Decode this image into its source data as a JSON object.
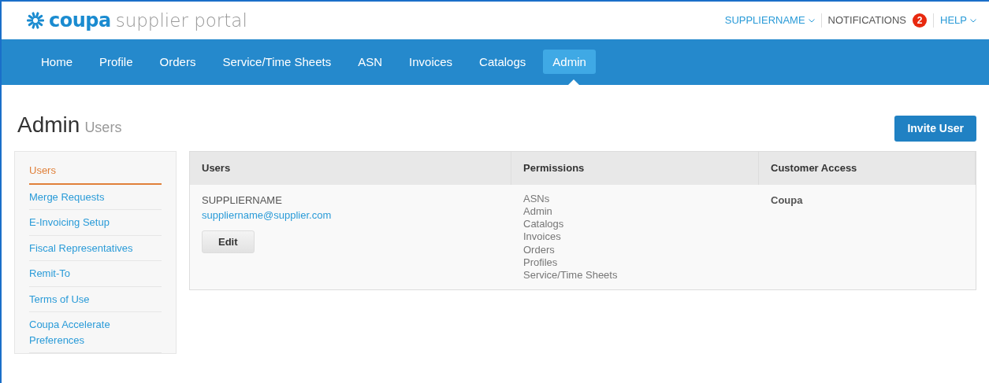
{
  "logo": {
    "brand": "coupa",
    "product": "supplier portal"
  },
  "top_links": [
    {
      "kind": "menu",
      "label": "SUPPLIERNAME"
    },
    {
      "kind": "badge",
      "label": "NOTIFICATIONS",
      "count": "2"
    },
    {
      "kind": "menu",
      "label": "HELP"
    }
  ],
  "tabs": [
    {
      "label": "Home",
      "selected": false
    },
    {
      "label": "Profile",
      "selected": false
    },
    {
      "label": "Orders",
      "selected": false
    },
    {
      "label": "Service/Time Sheets",
      "selected": false
    },
    {
      "label": "ASN",
      "selected": false
    },
    {
      "label": "Invoices",
      "selected": false
    },
    {
      "label": "Catalogs",
      "selected": false
    },
    {
      "label": "Admin",
      "selected": true
    }
  ],
  "page_title": {
    "main": "Admin",
    "sub": "Users"
  },
  "invite_button": "Invite User",
  "sidebar": {
    "items": [
      {
        "label": "Users",
        "selected": true
      },
      {
        "label": "Merge Requests",
        "selected": false
      },
      {
        "label": "E-Invoicing Setup",
        "selected": false
      },
      {
        "label": "Fiscal Representatives",
        "selected": false
      },
      {
        "label": "Remit-To",
        "selected": false
      },
      {
        "label": "Terms of Use",
        "selected": false
      },
      {
        "label": "Coupa Accelerate Preferences",
        "selected": false
      }
    ]
  },
  "table": {
    "columns": [
      "Users",
      "Permissions",
      "Customer Access"
    ],
    "rows": [
      {
        "name": "SUPPLIERNAME",
        "email": "suppliername@supplier.com",
        "button": "Edit",
        "permissions": [
          "ASNs",
          "Admin",
          "Catalogs",
          "Invoices",
          "Orders",
          "Profiles",
          "Service/Time Sheets"
        ],
        "customer_access": "Coupa"
      }
    ]
  }
}
